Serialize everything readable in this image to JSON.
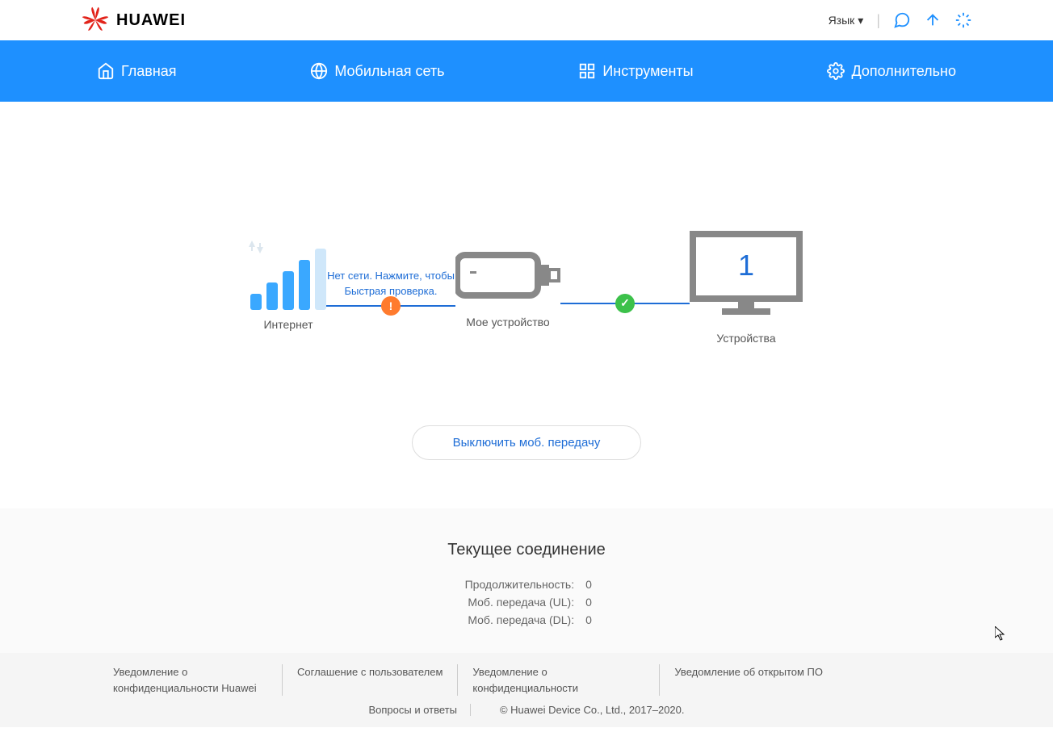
{
  "brand": "HUAWEI",
  "header": {
    "language_label": "Язык"
  },
  "nav": {
    "home": "Главная",
    "mobile": "Мобильная сеть",
    "tools": "Инструменты",
    "advanced": "Дополнительно"
  },
  "status": {
    "internet_label": "Интернет",
    "connector1_text": "Нет сети. Нажмите, чтобы Быстрая проверка.",
    "device_label": "Мое устройство",
    "devices_label": "Устройства",
    "device_count": "1"
  },
  "mobile_button": "Выключить моб. передачу",
  "connection": {
    "title": "Текущее соединение",
    "duration_label": "Продолжительность:",
    "duration_value": "0",
    "ul_label": "Моб. передача (UL):",
    "ul_value": "0",
    "dl_label": "Моб. передача (DL):",
    "dl_value": "0"
  },
  "footer": {
    "link1": "Уведомление о конфиденциальности Huawei",
    "link2": "Соглашение с пользователем",
    "link3": "Уведомление о конфиденциальности",
    "link4": "Уведомление об открытом ПО",
    "faq": "Вопросы и ответы",
    "copyright": "© Huawei Device Co., Ltd., 2017–2020."
  }
}
